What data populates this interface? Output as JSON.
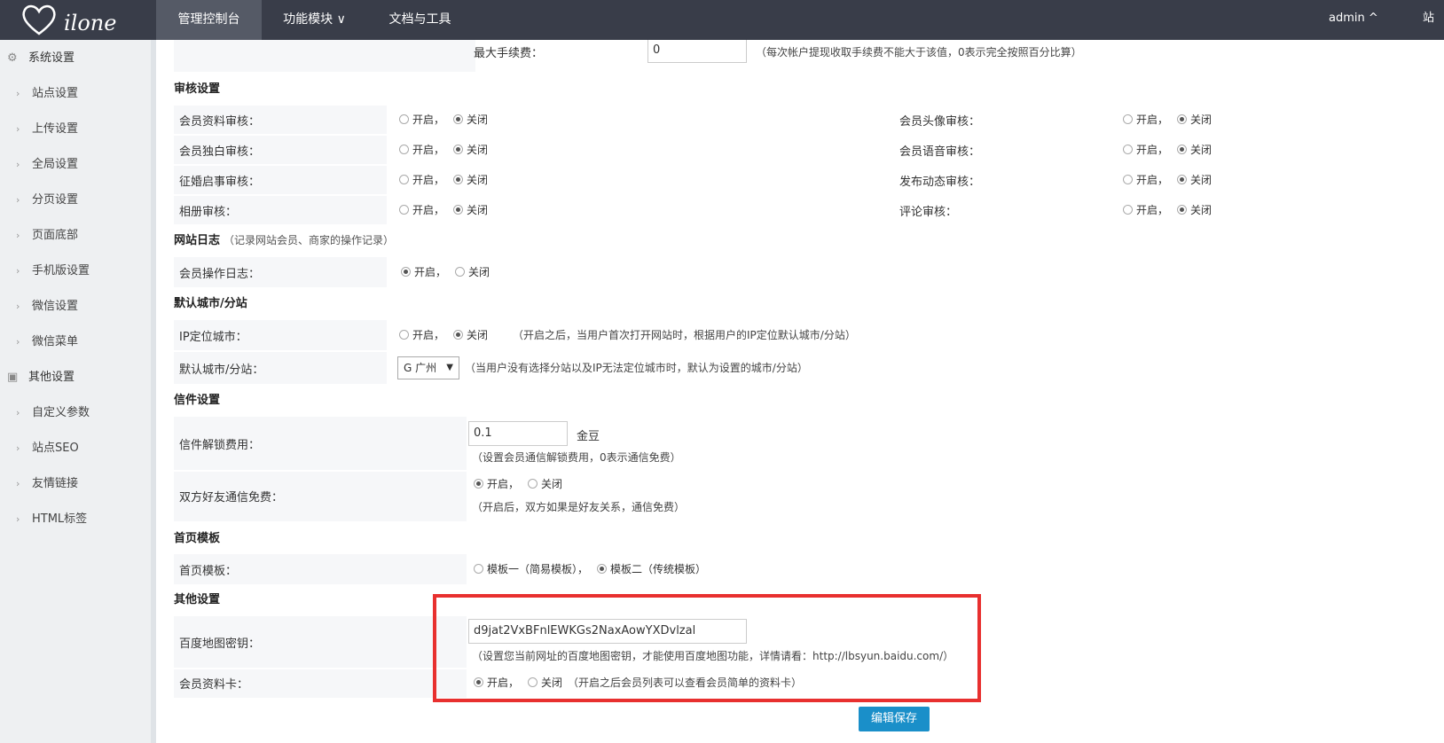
{
  "topbar": {
    "logo_text": "ilone",
    "nav": [
      "管理控制台",
      "功能模块 ∨",
      "文档与工具"
    ],
    "user": "admin ^",
    "site": "站内"
  },
  "sidebar": {
    "group1": "系统设置",
    "group1_items": [
      "站点设置",
      "上传设置",
      "全局设置",
      "分页设置",
      "页面底部",
      "手机版设置",
      "微信设置",
      "微信菜单"
    ],
    "group2": "其他设置",
    "group2_items": [
      "自定义参数",
      "站点SEO",
      "友情链接",
      "HTML标签"
    ]
  },
  "main": {
    "max_fee": {
      "label": "最大手续费：",
      "value": "0",
      "hint": "（每次帐户提现收取手续费不能大于该值，0表示完全按照百分比算）"
    },
    "audit": {
      "title": "审核设置",
      "left": [
        {
          "label": "会员资料审核：",
          "on": "开启，",
          "off": "关闭"
        },
        {
          "label": "会员独白审核：",
          "on": "开启，",
          "off": "关闭"
        },
        {
          "label": "征婚启事审核：",
          "on": "开启，",
          "off": "关闭"
        },
        {
          "label": "相册审核：",
          "on": "开启，",
          "off": "关闭"
        }
      ],
      "right": [
        {
          "label": "会员头像审核：",
          "on": "开启，",
          "off": "关闭"
        },
        {
          "label": "会员语音审核：",
          "on": "开启，",
          "off": "关闭"
        },
        {
          "label": "发布动态审核：",
          "on": "开启，",
          "off": "关闭"
        },
        {
          "label": "评论审核：",
          "on": "开启，",
          "off": "关闭"
        }
      ]
    },
    "log": {
      "title": "网站日志",
      "note": "（记录网站会员、商家的操作记录）",
      "label": "会员操作日志：",
      "on": "开启，",
      "off": "关闭"
    },
    "city": {
      "title": "默认城市/分站",
      "ip_label": "IP定位城市：",
      "ip_on": "开启，",
      "ip_off": "关闭",
      "ip_hint": "（开启之后，当用户首次打开网站时，根据用户的IP定位默认城市/分站）",
      "default_label": "默认城市/分站：",
      "default_value": "G 广州",
      "default_hint": "（当用户没有选择分站以及IP无法定位城市时，默认为设置的城市/分站）"
    },
    "letter": {
      "title": "信件设置",
      "fee_label": "信件解锁费用：",
      "fee_value": "0.1",
      "fee_unit": "金豆",
      "fee_hint": "（设置会员通信解锁费用，0表示通信免费）",
      "friend_label": "双方好友通信免费：",
      "friend_on": "开启，",
      "friend_off": "关闭",
      "friend_hint": "（开启后，双方如果是好友关系，通信免费）"
    },
    "template": {
      "title": "首页模板",
      "label": "首页模板：",
      "opt1": "模板一（简易模板），",
      "opt2": "模板二（传统模板）"
    },
    "other": {
      "title": "其他设置",
      "map_label": "百度地图密钥：",
      "map_value": "d9jat2VxBFnlEWKGs2NaxAowYXDvlzal",
      "map_hint": "（设置您当前网址的百度地图密钥，才能使用百度地图功能，详情请看：http://lbsyun.baidu.com/）",
      "card_label": "会员资料卡：",
      "card_on": "开启，",
      "card_off": "关闭",
      "card_hint": "（开启之后会员列表可以查看会员简单的资料卡）"
    },
    "save_button": "编辑保存"
  },
  "colors": {
    "topbar": "#393d49",
    "highlight": "#e8302f",
    "button": "#1a8fc9"
  }
}
